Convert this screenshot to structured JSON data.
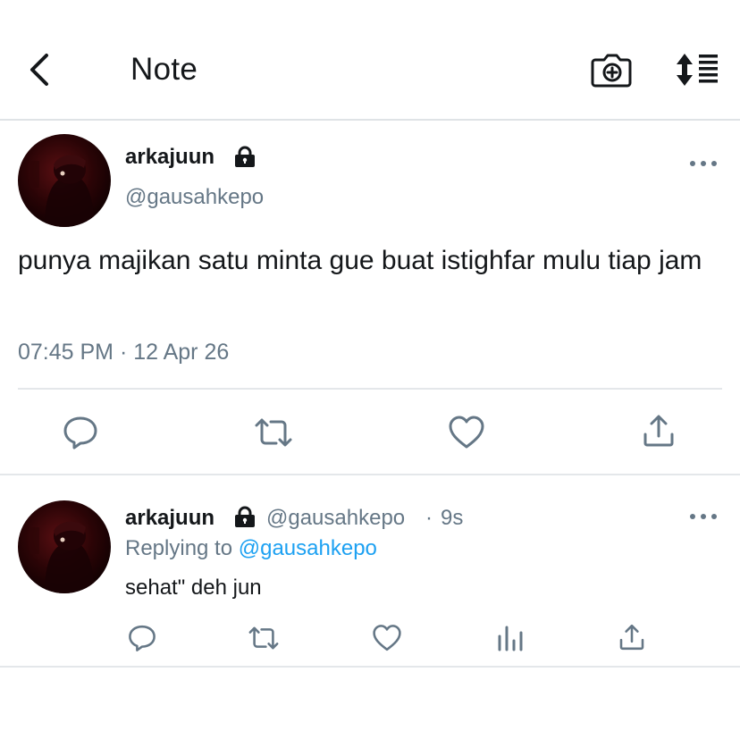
{
  "header": {
    "title": "Note",
    "icons": {
      "back": "chevron-left-icon",
      "camera": "camera-add-icon",
      "sort": "sort-list-icon"
    }
  },
  "tweet": {
    "display_name": "arkajuun",
    "handle": "@gausahkepo",
    "text": "punya majikan satu minta gue buat istighfar mulu tiap jam",
    "timestamp": "07:45 PM · 12 Apr 26",
    "actions": [
      "reply-icon",
      "retweet-icon",
      "like-icon",
      "share-icon"
    ]
  },
  "reply": {
    "display_name": "arkajuun",
    "handle": "@gausahkepo",
    "separator": "·",
    "time_ago": "9s",
    "replying_prefix": "Replying to",
    "replying_handle": "@gausahkepo",
    "text": "sehat\" deh jun",
    "actions": [
      "reply-icon",
      "retweet-icon",
      "like-icon",
      "analytics-icon",
      "share-icon"
    ]
  },
  "colors": {
    "text_primary": "#14171a",
    "text_secondary": "#657786",
    "link": "#1da1f2",
    "divider": "#e4e7ea",
    "icon": "#657786"
  }
}
